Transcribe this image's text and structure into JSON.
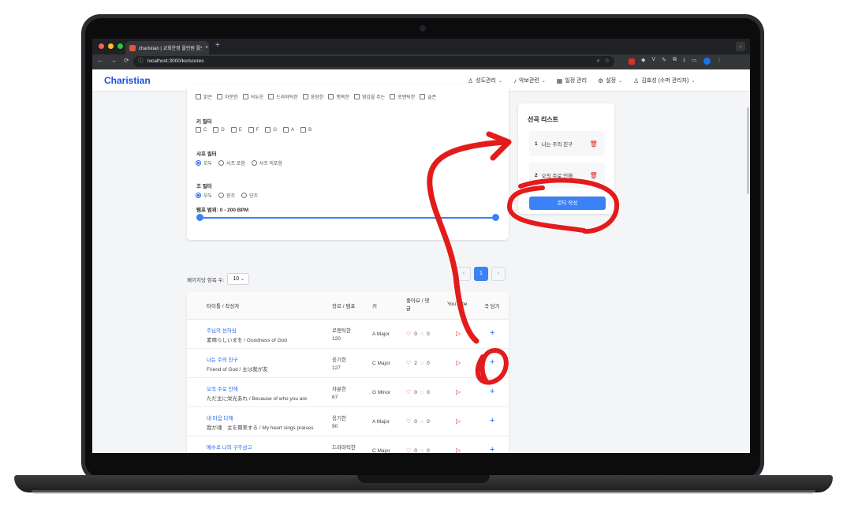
{
  "browser": {
    "tab_title": "charistian | 교회운영 올인원 플랫",
    "tab_close": "×",
    "new_tab": "+",
    "tab_menu": "⌄",
    "url": "localhost:3000/ko/scores",
    "nav": {
      "back": "←",
      "forward": "→",
      "reload": "⟳"
    },
    "omni_icons": [
      "⌕",
      "☆"
    ],
    "ext_icons": [
      "◆",
      "V",
      "✎",
      "⧉",
      "⤓",
      "▭",
      "⋮"
    ]
  },
  "app": {
    "brand": "Charistian",
    "menu": [
      {
        "icon": "users-icon",
        "glyph": "♙",
        "label": "성도관리"
      },
      {
        "icon": "sheet-music-icon",
        "glyph": "♪",
        "label": "악보관련"
      },
      {
        "icon": "calendar-icon",
        "glyph": "▦",
        "label": "일정 관리"
      },
      {
        "icon": "gear-icon",
        "glyph": "⚙",
        "label": "설정"
      },
      {
        "icon": "user-icon",
        "glyph": "♙",
        "label": "김효성 (수퍼 관리자)"
      }
    ]
  },
  "filters": {
    "moods": [
      "밝은",
      "차분한",
      "어두운",
      "드라마틱한",
      "웅장한",
      "행복한",
      "영감을 주는",
      "로맨틱한",
      "슬픈"
    ],
    "key_label": "키 필터",
    "keys": [
      "C",
      "D",
      "E",
      "F",
      "G",
      "A",
      "B"
    ],
    "sharp_label": "샤프 필터",
    "sharp_options": [
      "모두",
      "샤프 포함",
      "샤프 미포함"
    ],
    "sharp_selected": 0,
    "mode_label": "조 필터",
    "mode_options": [
      "모두",
      "장조",
      "단조"
    ],
    "mode_selected": 0,
    "tempo_label": "템포 범위: 0 - 200 BPM",
    "tempo_min": 0,
    "tempo_max": 200
  },
  "pick_list": {
    "title": "선곡 리스트",
    "items": [
      {
        "num": "1",
        "name": "나는 주의 친구"
      },
      {
        "num": "2",
        "name": "오직 주로 인해"
      }
    ],
    "button": "콘티 작성"
  },
  "pagination": {
    "per_page_label": "페이지당 항목 수:",
    "per_page_value": "10",
    "prev": "‹",
    "current": "1",
    "next": "›"
  },
  "table": {
    "headers": {
      "title": "타이틀 / 작성자",
      "genre": "장르 / 템포",
      "key": "키",
      "likes_a": "좋아요 / 댓",
      "likes_b": "글",
      "youtube": "YouTube",
      "add": "곡 담기"
    },
    "rows": [
      {
        "title": "주님의 선하심",
        "subtitle": "素晴らしいまを / Goodness of God",
        "genre": "로맨틱한",
        "tempo": "120",
        "key": "A Major",
        "likes": "0",
        "comments": "0"
      },
      {
        "title": "나는 주의 친구",
        "subtitle": "Friend of God / 主は我が友",
        "genre": "웅기한",
        "tempo": "127",
        "key": "C Major",
        "likes": "2",
        "comments": "0"
      },
      {
        "title": "오직 주로 인해",
        "subtitle": "ただ主に栄光あれ / Because of who you are",
        "genre": "차분한",
        "tempo": "67",
        "key": "G Minor",
        "likes": "0",
        "comments": "0"
      },
      {
        "title": "내 마음 다해",
        "subtitle": "我が魂　主を賛美する / My heart sings praises",
        "genre": "웅기한",
        "tempo": "90",
        "key": "A Major",
        "likes": "0",
        "comments": "0"
      },
      {
        "title": "예수로 나의 구주삼고",
        "subtitle": "",
        "genre": "드라마틱한",
        "tempo": "",
        "key": "C Major",
        "likes": "0",
        "comments": "0"
      }
    ],
    "icons": {
      "heart": "♡",
      "bubble": "◌",
      "youtube": "▷",
      "add": "+"
    }
  },
  "colors": {
    "brand": "#1d4ed8",
    "accent": "#3b82f6",
    "annotation": "#e31b1b",
    "danger": "#dc2626"
  }
}
